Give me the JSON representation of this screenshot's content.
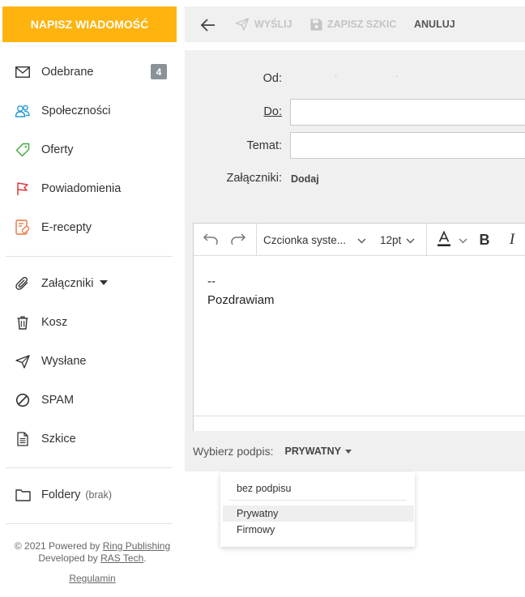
{
  "compose_button": "NAPISZ WIADOMOŚĆ",
  "nav": {
    "inbox": {
      "label": "Odebrane",
      "badge": "4"
    },
    "social": {
      "label": "Społeczności"
    },
    "offers": {
      "label": "Oferty"
    },
    "notifications": {
      "label": "Powiadomienia"
    },
    "erecepty": {
      "label": "E-recepty"
    },
    "attachments": {
      "label": "Załączniki"
    },
    "trash": {
      "label": "Kosz"
    },
    "sent": {
      "label": "Wysłane"
    },
    "spam": {
      "label": "SPAM"
    },
    "drafts": {
      "label": "Szkice"
    },
    "folders": {
      "label": "Foldery",
      "sub": "(brak)"
    }
  },
  "footer": {
    "line1_prefix": "© 2021 Powered by ",
    "line1_link": "Ring Publishing",
    "line2_prefix": "Developed by ",
    "line2_link": "RAS Tech",
    "line2_suffix": ".",
    "terms": "Regulamin"
  },
  "toolbar": {
    "send": "WYŚLIJ",
    "save_draft": "ZAPISZ SZKIC",
    "cancel": "ANULUJ"
  },
  "form": {
    "from_label": "Od:",
    "to_label": "Do:",
    "subject_label": "Temat:",
    "attachments_label": "Załączniki:",
    "add_link": "Dodaj"
  },
  "editor": {
    "font_family": "Czcionka syste...",
    "font_size": "12pt",
    "body_line1": "--",
    "body_line2": "Pozdrawiam"
  },
  "signature": {
    "label": "Wybierz podpis:",
    "selected": "PRYWATNY",
    "options": [
      "bez podpisu",
      "Prywatny",
      "Firmowy"
    ]
  },
  "colors": {
    "accent": "#ffb30f",
    "panel_bg": "#f0f0f0"
  }
}
